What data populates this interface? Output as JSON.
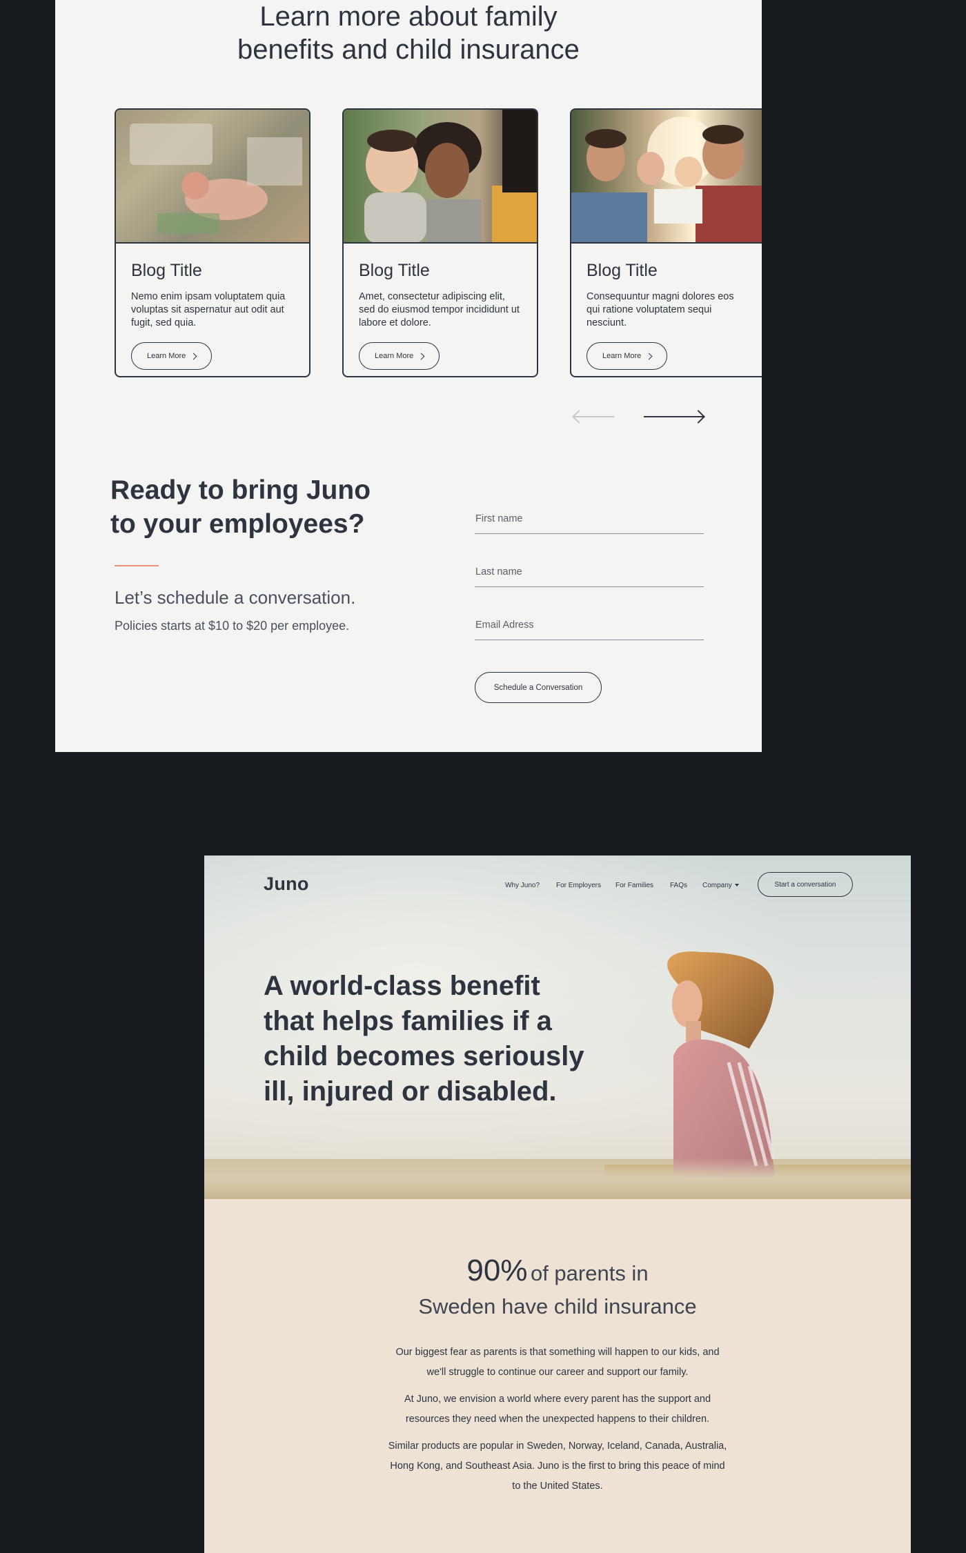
{
  "blog_section": {
    "title_line1": "Learn more about family",
    "title_line2": "benefits and child insurance",
    "cards": [
      {
        "title": "Blog Title",
        "text": "Nemo enim ipsam voluptatem quia voluptas sit aspernatur aut odit aut fugit, sed quia.",
        "button": "Learn More"
      },
      {
        "title": "Blog Title",
        "text": "Amet, consectetur adipiscing elit, sed do eiusmod tempor incididunt ut labore et dolore.",
        "button": "Learn More"
      },
      {
        "title": "Blog Title",
        "text": "Consequuntur magni dolores eos qui ratione voluptatem sequi nesciunt.",
        "button": "Learn More"
      }
    ]
  },
  "cta": {
    "title_line1": "Ready to bring Juno",
    "title_line2": "to your employees?",
    "subtitle": "Let’s schedule a conversation.",
    "note": "Policies starts at $10 to $20 per employee.",
    "fields": {
      "first_name": "First name",
      "last_name": "Last name",
      "email": "Email Adress"
    },
    "button": "Schedule a Conversation"
  },
  "header": {
    "logo": "Juno",
    "nav": [
      "Why Juno?",
      "For Employers",
      "For Families",
      "FAQs",
      "Company"
    ],
    "cta": "Start a conversation"
  },
  "hero": {
    "title": "A world-class benefit that helps families if a child becomes seriously ill, injured or disabled."
  },
  "stat": {
    "value": "90%",
    "text_line1": "of parents in",
    "text_line2": "Sweden have child insurance",
    "paragraphs": [
      "Our biggest fear as parents is that something will happen to our kids, and we'll struggle to continue our career and support our family.",
      "At Juno, we envision a world where every parent has the support and resources they need when the unexpected happens to their children.",
      "Similar products are popular in Sweden, Norway, Iceland, Canada, Australia, Hong Kong, and Southeast Asia. Juno is the first to bring this peace of mind to the United States."
    ]
  }
}
